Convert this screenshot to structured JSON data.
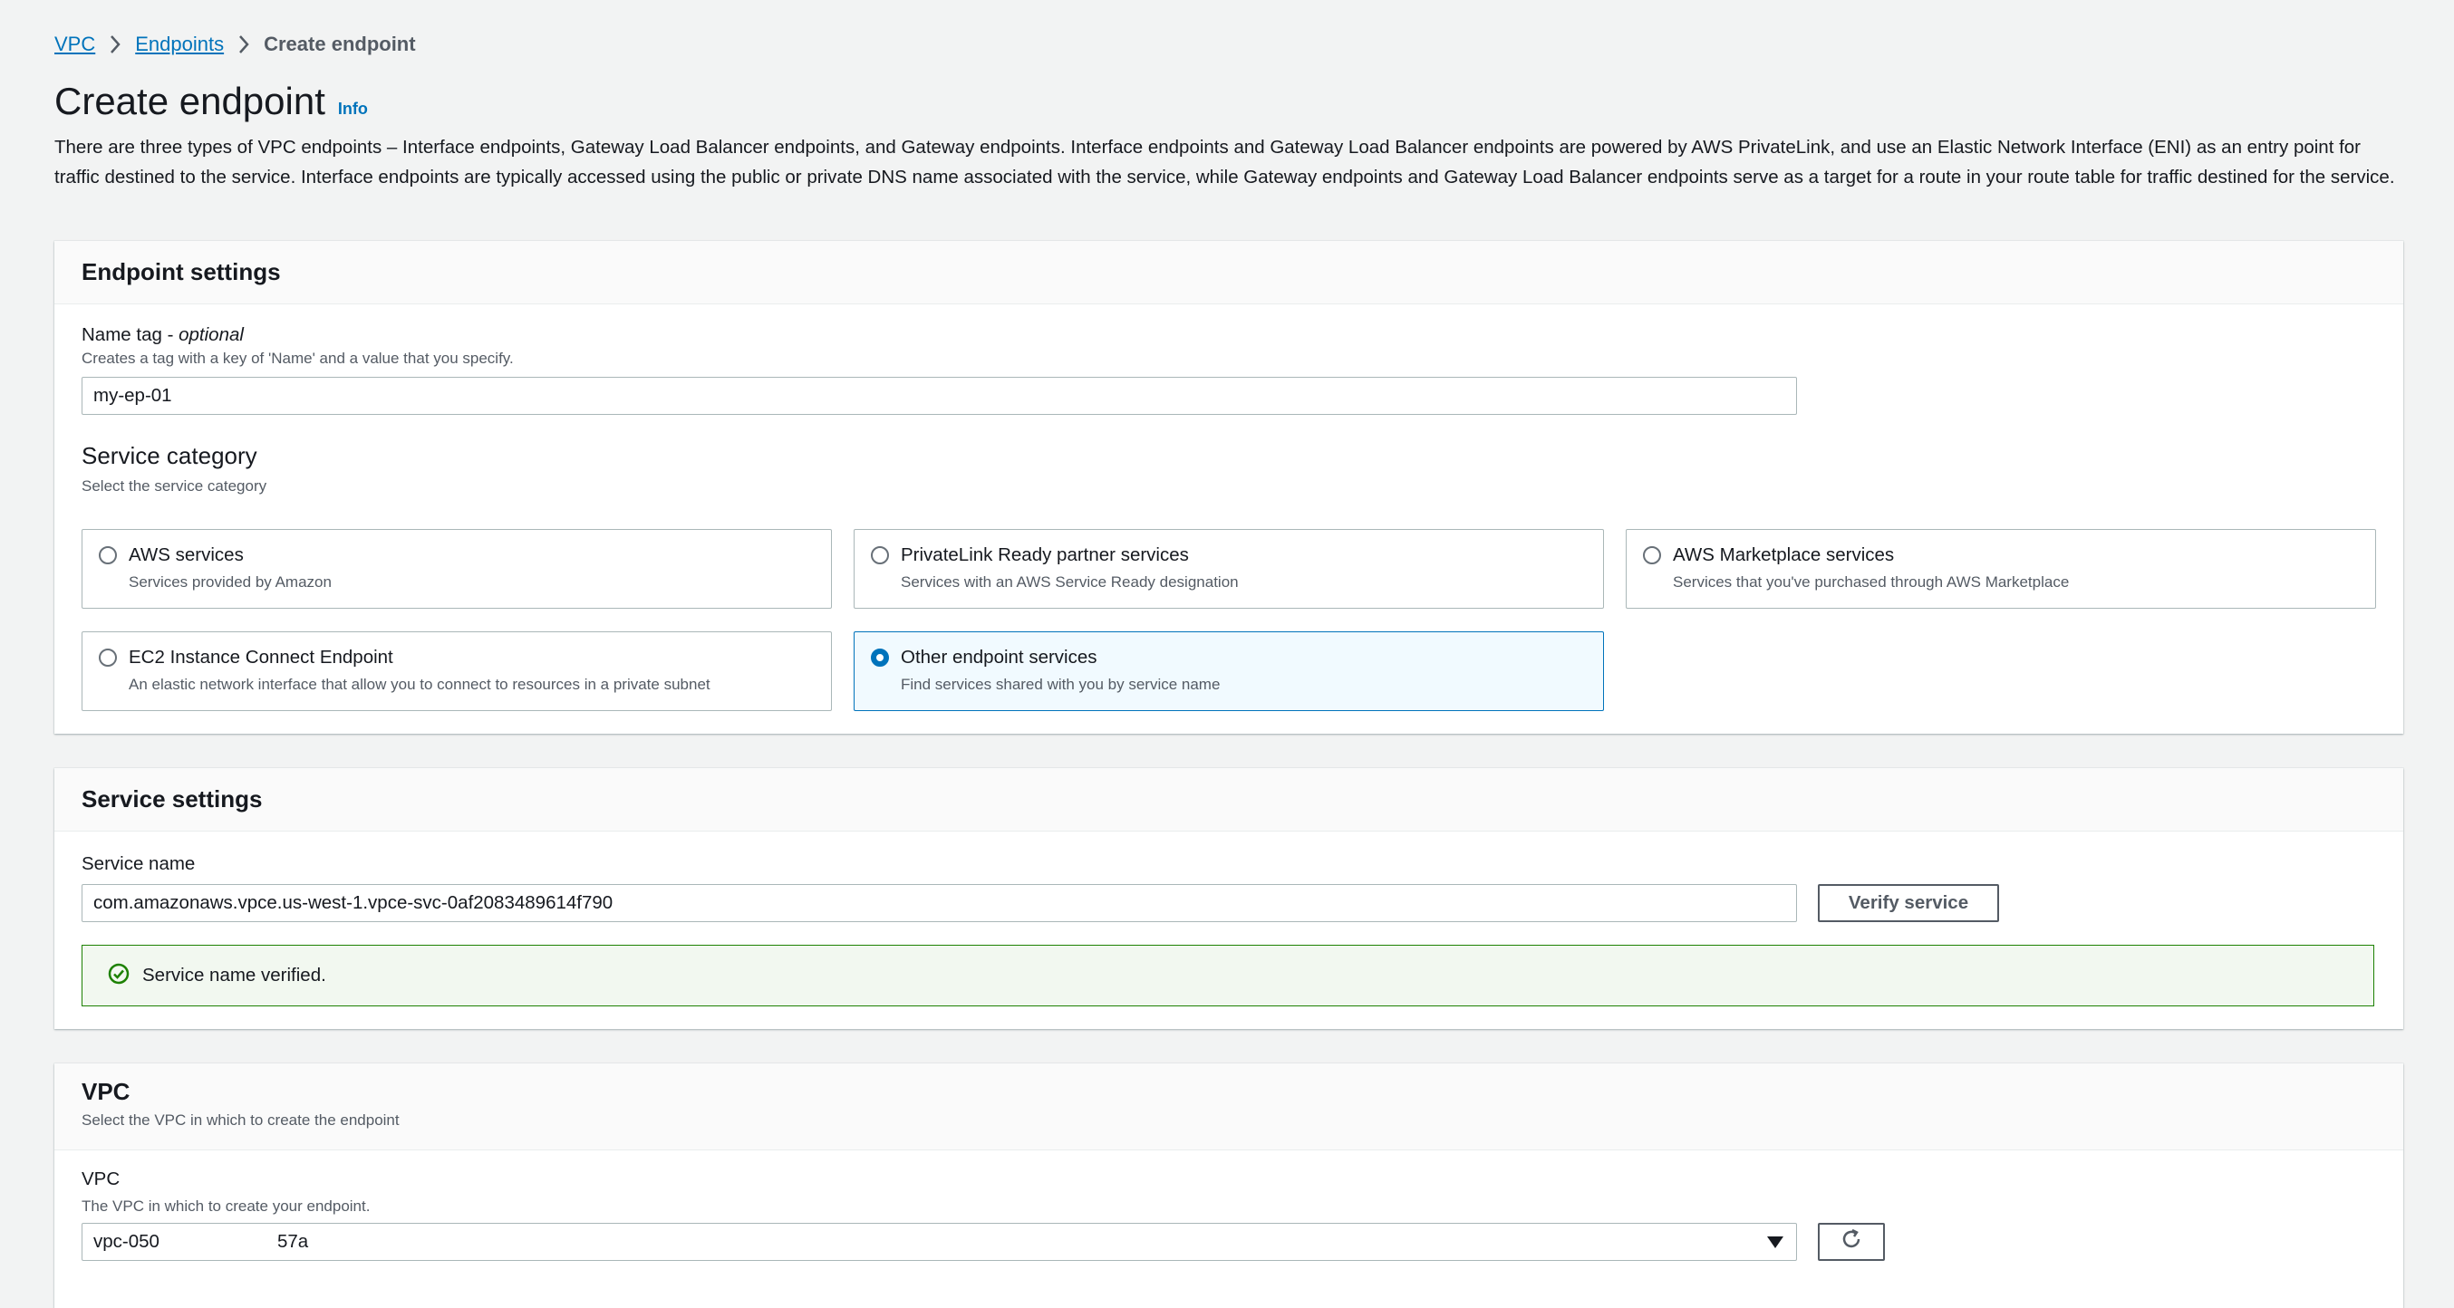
{
  "breadcrumb": {
    "items": [
      "VPC",
      "Endpoints"
    ],
    "current": "Create endpoint"
  },
  "header": {
    "title": "Create endpoint",
    "info": "Info",
    "description": "There are three types of VPC endpoints – Interface endpoints, Gateway Load Balancer endpoints, and Gateway endpoints. Interface endpoints and Gateway Load Balancer endpoints are powered by AWS PrivateLink, and use an Elastic Network Interface (ENI) as an entry point for traffic destined to the service. Interface endpoints are typically accessed using the public or private DNS name associated with the service, while Gateway endpoints and Gateway Load Balancer endpoints serve as a target for a route in your route table for traffic destined for the service."
  },
  "endpoint_settings": {
    "title": "Endpoint settings",
    "name_tag": {
      "label": "Name tag - ",
      "label_optional": "optional",
      "description": "Creates a tag with a key of 'Name' and a value that you specify.",
      "value": "my-ep-01"
    },
    "service_category": {
      "title": "Service category",
      "description": "Select the service category",
      "options": [
        {
          "label": "AWS services",
          "description": "Services provided by Amazon",
          "selected": false
        },
        {
          "label": "PrivateLink Ready partner services",
          "description": "Services with an AWS Service Ready designation",
          "selected": false
        },
        {
          "label": "AWS Marketplace services",
          "description": "Services that you've purchased through AWS Marketplace",
          "selected": false
        },
        {
          "label": "EC2 Instance Connect Endpoint",
          "description": "An elastic network interface that allow you to connect to resources in a private subnet",
          "selected": false
        },
        {
          "label": "Other endpoint services",
          "description": "Find services shared with you by service name",
          "selected": true
        }
      ]
    }
  },
  "service_settings": {
    "title": "Service settings",
    "service_name": {
      "label": "Service name",
      "value": "com.amazonaws.vpce.us-west-1.vpce-svc-0af2083489614f790"
    },
    "verify_button": "Verify service",
    "alert": "Service name verified."
  },
  "vpc": {
    "title": "VPC",
    "description": "Select the VPC in which to create the endpoint",
    "field_label": "VPC",
    "field_description": "The VPC in which to create your endpoint.",
    "value_prefix": "vpc-050",
    "value_suffix": "57a"
  },
  "colors": {
    "link": "#0073bb",
    "selected": "#0073bb",
    "success": "#1d8102",
    "background": "#f2f3f3"
  },
  "icons": [
    "chevron-right-icon",
    "check-circle-icon",
    "caret-down-icon",
    "refresh-icon"
  ]
}
